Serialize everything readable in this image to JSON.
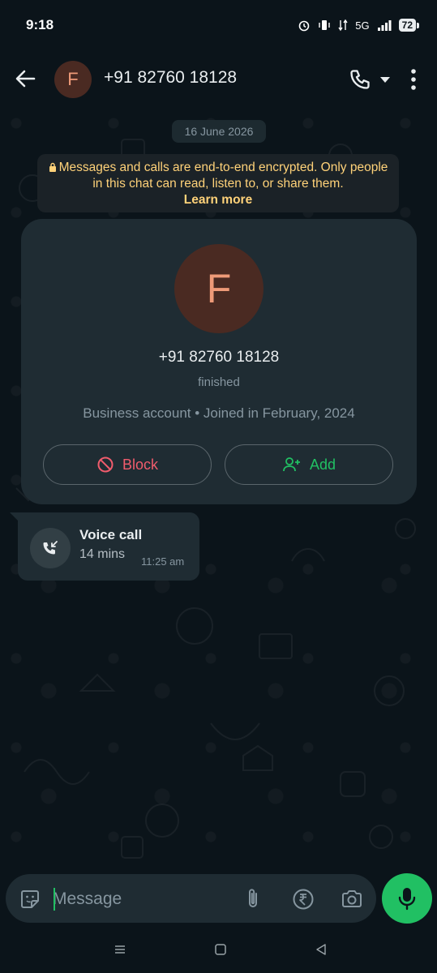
{
  "status_bar": {
    "time": "9:18",
    "battery": "72",
    "network": "5G"
  },
  "header": {
    "avatar_letter": "F",
    "title": "+91 82760 18128"
  },
  "chat": {
    "date_chip": "16 June 2026",
    "encryption_notice": {
      "text": "Messages and calls are end-to-end encrypted. Only people in this chat can read, listen to, or share them.",
      "link": "Learn more"
    },
    "profile_card": {
      "avatar_letter": "F",
      "name": "+91 82760 18128",
      "status": "finished",
      "info": "Business account • Joined in February, 2024",
      "block_label": "Block",
      "add_label": "Add"
    },
    "call_message": {
      "title": "Voice call",
      "duration": "14 mins",
      "time": "11:25 am"
    }
  },
  "input_bar": {
    "placeholder": "Message"
  },
  "colors": {
    "background": "#0b141a",
    "bubble": "#1f2c33",
    "accent_green": "#21c063",
    "block_red": "#f15c6d",
    "notice_yellow": "#ffd279",
    "avatar_bg": "#4a2a22",
    "avatar_fg": "#ee9a78"
  },
  "icons": [
    "back-arrow-icon",
    "phone-icon",
    "caret-down-icon",
    "more-vert-icon",
    "lock-icon",
    "block-icon",
    "add-contact-icon",
    "missed-incoming-call-icon",
    "sticker-icon",
    "attach-icon",
    "rupee-icon",
    "camera-icon",
    "mic-icon"
  ]
}
